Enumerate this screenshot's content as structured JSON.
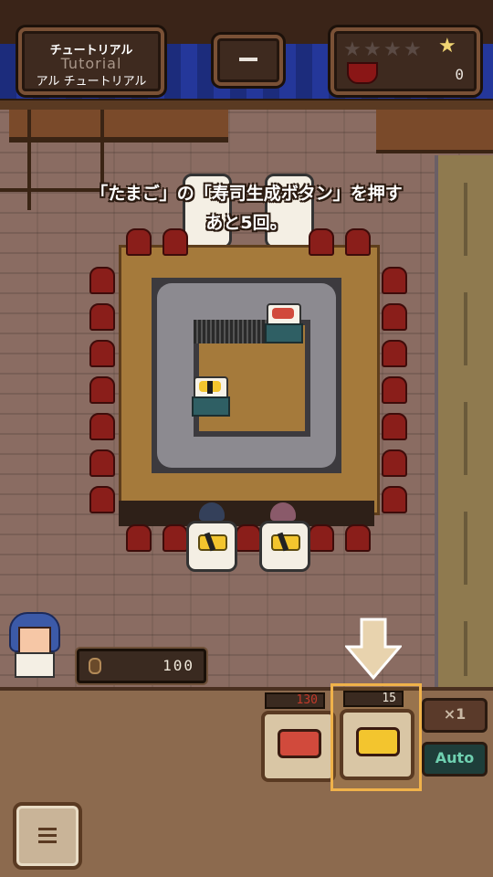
{
  "header": {
    "tutorial_title": "チュートリアル",
    "tutorial_subtitle": "Tutorial",
    "tutorial_label": "アル チュートリアル",
    "score_value": "0",
    "stars_total": 5,
    "stars_filled": 0
  },
  "tutorial_message": {
    "line1": "「たまご」の「寿司生成ボタン」を押す",
    "line2": "あと5回。"
  },
  "player": {
    "money": "100"
  },
  "generators": [
    {
      "name": "tuna",
      "price": "130",
      "selected": false
    },
    {
      "name": "tamago",
      "price": "15",
      "selected": true
    }
  ],
  "controls": {
    "speed_label": "×1",
    "auto_label": "Auto"
  },
  "colors": {
    "curtain": "#24379a",
    "highlight": "#f0b24a",
    "counter": "#a57a3b",
    "tamago": "#f3c52e",
    "tuna": "#d14a3c"
  },
  "icons": [
    "menu-icon",
    "coin-icon",
    "star-icon",
    "down-arrow-icon",
    "minus-icon"
  ]
}
